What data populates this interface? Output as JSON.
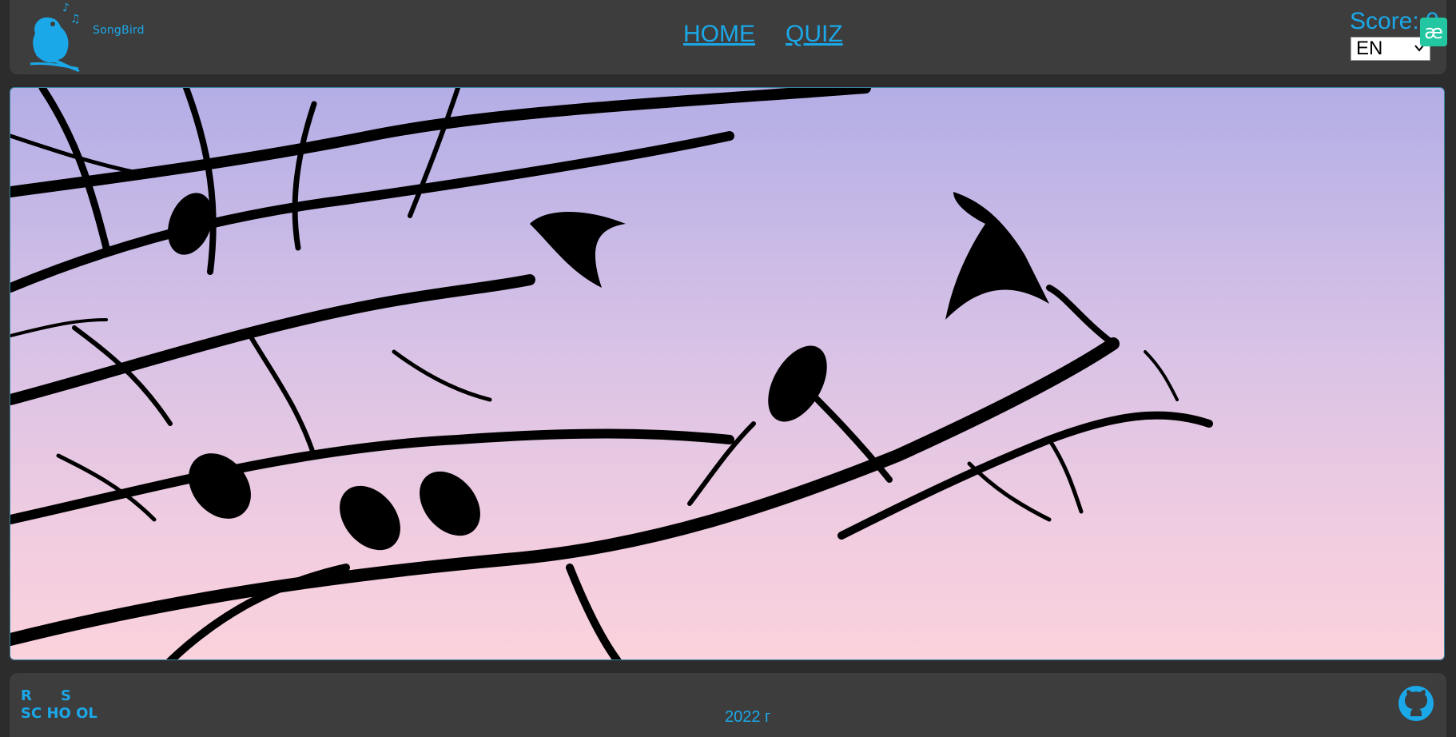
{
  "header": {
    "logo_text": "SongBird",
    "nav": [
      {
        "label": "HOME"
      },
      {
        "label": "QUIZ"
      }
    ],
    "score_text": "Score: 0",
    "language": {
      "selected": "EN"
    },
    "extension_icon_text": "æ"
  },
  "hero": {
    "image": "birds-on-branches-icon",
    "sky_gradient": [
      "#b3aee6",
      "#fad2dc"
    ]
  },
  "footer": {
    "rs_school_logo_text": "RS SCHOOL",
    "year_text": "2022 г",
    "github_icon": "github-icon"
  },
  "colors": {
    "accent": "#1ba8e8",
    "panel": "#3d3d3d",
    "page": "#2c2c2c"
  }
}
